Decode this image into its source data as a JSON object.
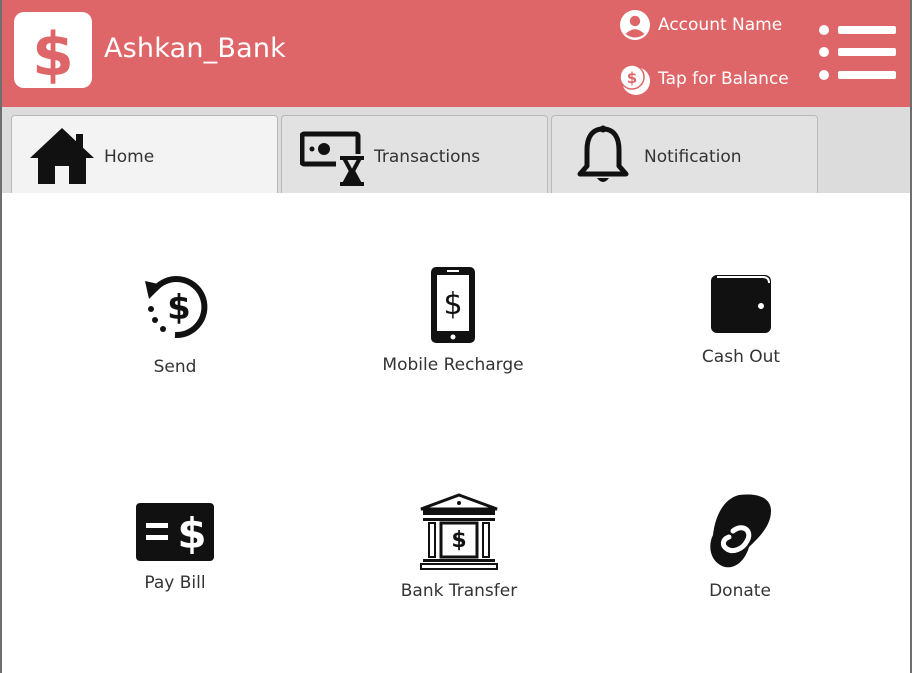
{
  "header": {
    "brand": "Ashkan_Bank",
    "brand_color": "#df6668",
    "logo_icon": "dollar-sign-icon",
    "account": {
      "label": "Account Name",
      "icon": "user-circle-icon"
    },
    "balance": {
      "label": "Tap for Balance",
      "icon": "coins-icon"
    },
    "menu_icon": "hamburger-menu-icon"
  },
  "tabs": [
    {
      "label": "Home",
      "icon": "home-icon",
      "active": true
    },
    {
      "label": "Transactions",
      "icon": "money-hourglass-icon",
      "active": false
    },
    {
      "label": "Notification",
      "icon": "bell-icon",
      "active": false
    }
  ],
  "services": [
    {
      "label": "Send",
      "icon": "send-money-icon"
    },
    {
      "label": "Mobile Recharge",
      "icon": "mobile-dollar-icon"
    },
    {
      "label": "Cash Out",
      "icon": "wallet-icon"
    },
    {
      "label": "Pay Bill",
      "icon": "bill-dollar-icon"
    },
    {
      "label": "Bank Transfer",
      "icon": "bank-building-icon"
    },
    {
      "label": "Donate",
      "icon": "donate-hand-icon"
    }
  ]
}
